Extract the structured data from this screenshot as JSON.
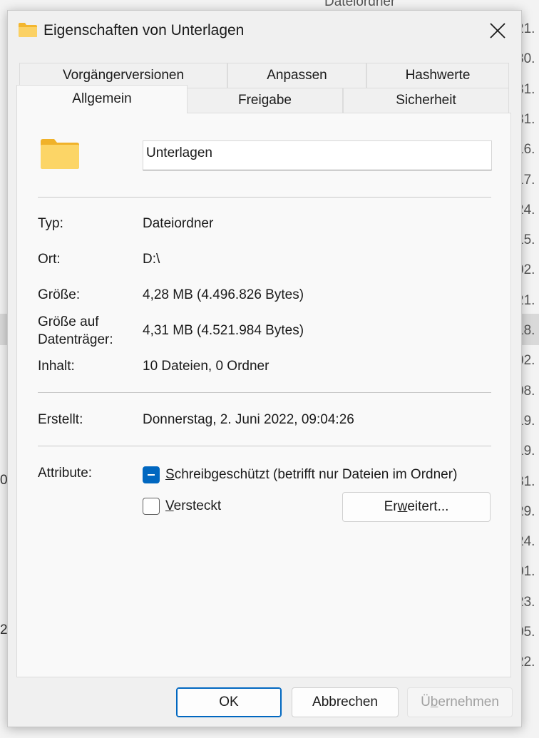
{
  "background": {
    "top_text": "Dateiordner",
    "dates": [
      "21.",
      "30.",
      "31.",
      "31.",
      "16.",
      "17.",
      "24.",
      "15.",
      "02.",
      "21.",
      "18.",
      "02.",
      "08.",
      "19.",
      "19.",
      "31.",
      "29.",
      "24.",
      "01.",
      "23.",
      "05.",
      "22."
    ],
    "left_fragments": [
      "0",
      "2"
    ]
  },
  "dialog": {
    "title": "Eigenschaften von Unterlagen",
    "tabs": {
      "row1": [
        "Vorgängerversionen",
        "Anpassen",
        "Hashwerte"
      ],
      "row2": [
        "Allgemein",
        "Freigabe",
        "Sicherheit"
      ]
    },
    "general": {
      "name_value": "Unterlagen",
      "rows": {
        "typ": {
          "label": "Typ:",
          "value": "Dateiordner"
        },
        "ort": {
          "label": "Ort:",
          "value": "D:\\"
        },
        "groesse": {
          "label": "Größe:",
          "value": "4,28 MB (4.496.826 Bytes)"
        },
        "groesse_dt": {
          "label_1": "Größe auf",
          "label_2": "Datenträger:",
          "value": "4,31 MB (4.521.984 Bytes)"
        },
        "inhalt": {
          "label": "Inhalt:",
          "value": "10 Dateien, 0 Ordner"
        },
        "erstellt": {
          "label": "Erstellt:",
          "value": "Donnerstag, 2. Juni 2022, 09:04:26"
        }
      },
      "attributes": {
        "label": "Attribute:",
        "readonly": {
          "mnemonic": "S",
          "rest": "chreibgeschützt (betrifft nur Dateien im Ordner)",
          "state": "indeterminate"
        },
        "hidden": {
          "mnemonic": "V",
          "rest": "ersteckt",
          "state": "unchecked"
        },
        "advanced": {
          "pre": "Er",
          "mnemonic": "w",
          "post": "eitert..."
        }
      }
    },
    "buttons": {
      "ok": "OK",
      "cancel": "Abbrechen",
      "apply": {
        "pre": "Ü",
        "mnemonic": "b",
        "post": "ernehmen",
        "enabled": false
      }
    }
  },
  "colors": {
    "accent": "#0067c0",
    "folder": "#f8c64a"
  }
}
